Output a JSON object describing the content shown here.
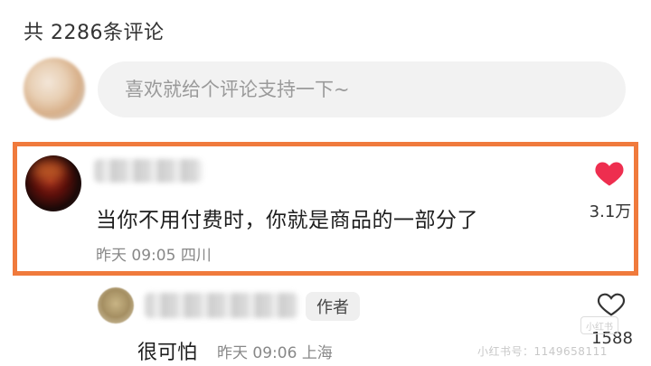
{
  "header": {
    "comment_count": "共 2286条评论"
  },
  "input": {
    "placeholder": "喜欢就给个评论支持一下~"
  },
  "top_comment": {
    "text": "当你不用付费时，你就是商品的一部分了",
    "time": "昨天 09:05",
    "location": "四川",
    "like_count": "3.1万",
    "liked": true,
    "like_color": "#ee2e4f"
  },
  "reply": {
    "badge": "作者",
    "text": "很可怕",
    "time": "昨天 09:06",
    "location": "上海",
    "like_count": "1588",
    "liked": false
  },
  "watermark": {
    "text": "小红书号：1149658111",
    "logo": "小红书"
  },
  "colors": {
    "highlight_border": "#f07a3c"
  }
}
